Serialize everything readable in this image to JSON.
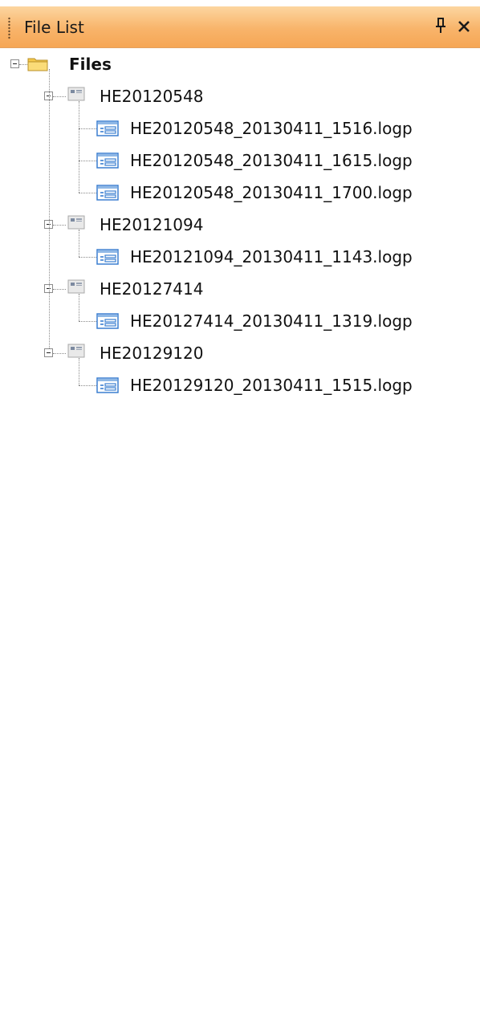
{
  "panel": {
    "title": "File List",
    "pin_icon": "pin-icon",
    "close_icon": "close-icon"
  },
  "tree": {
    "root": {
      "label": "Files",
      "icon": "folder-icon",
      "expanded": true
    },
    "groups": [
      {
        "label": "HE20120548",
        "icon": "device-icon",
        "expanded": true,
        "files": [
          {
            "label": "HE20120548_20130411_1516.logp",
            "icon": "log-file-icon"
          },
          {
            "label": "HE20120548_20130411_1615.logp",
            "icon": "log-file-icon"
          },
          {
            "label": "HE20120548_20130411_1700.logp",
            "icon": "log-file-icon"
          }
        ]
      },
      {
        "label": "HE20121094",
        "icon": "device-icon",
        "expanded": true,
        "files": [
          {
            "label": "HE20121094_20130411_1143.logp",
            "icon": "log-file-icon"
          }
        ]
      },
      {
        "label": "HE20127414",
        "icon": "device-icon",
        "expanded": true,
        "files": [
          {
            "label": "HE20127414_20130411_1319.logp",
            "icon": "log-file-icon"
          }
        ]
      },
      {
        "label": "HE20129120",
        "icon": "device-icon",
        "expanded": true,
        "files": [
          {
            "label": "HE20129120_20130411_1515.logp",
            "icon": "log-file-icon"
          }
        ]
      }
    ]
  },
  "colors": {
    "title_gradient_top": "#fcd6a0",
    "title_gradient_bottom": "#f6a655",
    "tree_line": "#8a8a8a",
    "file_icon_blue": "#3b7fd0",
    "folder_yellow": "#f5c94a"
  }
}
